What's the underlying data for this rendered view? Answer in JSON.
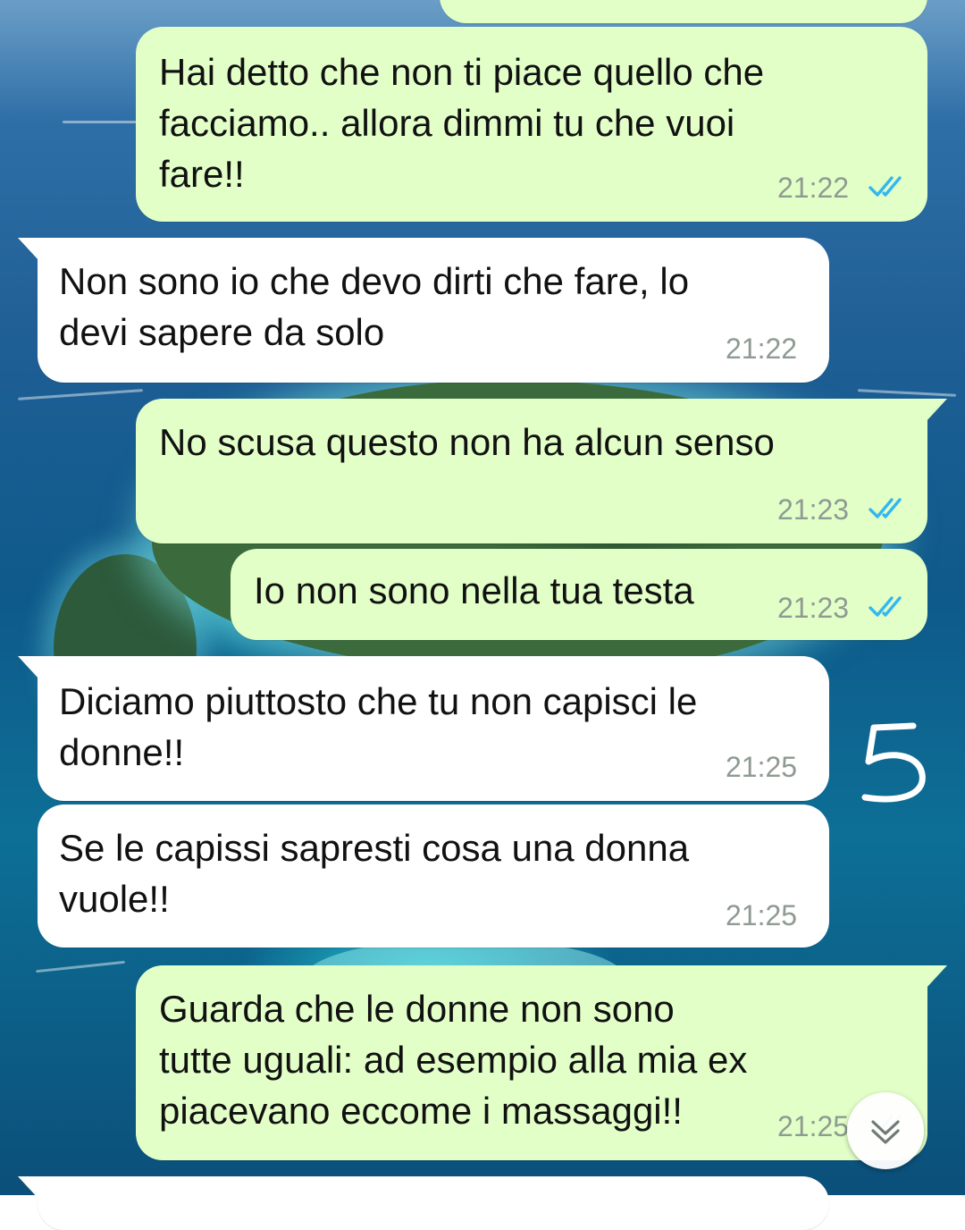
{
  "chat": {
    "messages": [
      {
        "direction": "outgoing",
        "text_lines": [
          "Hai detto che non ti piace quello che",
          "facciamo.. allora dimmi tu che vuoi",
          "fare!!"
        ],
        "time": "21:22",
        "status": "read"
      },
      {
        "direction": "incoming",
        "text_lines": [
          "Non sono io che devo dirti che fare, lo",
          "devi sapere da solo"
        ],
        "time": "21:22"
      },
      {
        "direction": "outgoing",
        "text_lines": [
          "No scusa questo non ha alcun senso"
        ],
        "time": "21:23",
        "status": "read"
      },
      {
        "direction": "outgoing",
        "text_lines": [
          "Io non sono nella tua testa"
        ],
        "time": "21:23",
        "status": "read"
      },
      {
        "direction": "incoming",
        "text_lines": [
          "Diciamo piuttosto che tu non capisci le",
          "donne!!"
        ],
        "time": "21:25"
      },
      {
        "direction": "incoming",
        "text_lines": [
          "Se le capissi sapresti cosa una donna",
          "vuole!!"
        ],
        "time": "21:25"
      },
      {
        "direction": "outgoing",
        "text_lines": [
          "Guarda che le donne non sono",
          "tutte uguali: ad esempio alla mia ex",
          "piacevano eccome i massaggi!!"
        ],
        "time": "21:25",
        "status": "read"
      }
    ]
  },
  "annotation": {
    "text": "5"
  },
  "icons": {
    "read_receipt": "double-check-icon",
    "scroll_down": "chevron-double-down-icon"
  },
  "colors": {
    "outgoing_bubble": "#e2ffc8",
    "incoming_bubble": "#ffffff",
    "read_tick": "#34b7f1",
    "timestamp": "#8f9a92"
  }
}
